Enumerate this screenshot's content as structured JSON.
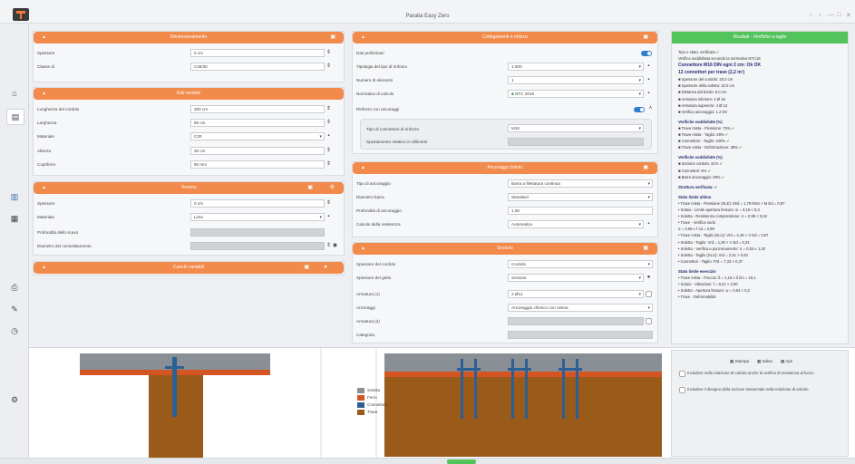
{
  "app": {
    "title": "Paratia Easy Zero"
  },
  "window_controls": [
    "‹",
    "›",
    "—",
    "□",
    "✕"
  ],
  "sidebar": {
    "icons": [
      "home-icon",
      "calendar-icon",
      "layers-icon",
      "book-icon",
      "print-icon",
      "edit-icon",
      "clock-icon",
      "gear-icon"
    ]
  },
  "panels": {
    "dimensions": {
      "title": "Dimensionamento",
      "rows": [
        {
          "label": "Spessore",
          "value": "0 cm"
        },
        {
          "label": "Classe di",
          "value": "C25/30"
        }
      ]
    },
    "geometry": {
      "title": "Dati cordolo",
      "rows": [
        {
          "label": "Lunghezza del cordolo",
          "value": "300 cm"
        },
        {
          "label": "Larghezza",
          "value": "50 cm"
        },
        {
          "label": "Materiale",
          "value": "C20"
        },
        {
          "label": "Altezza",
          "value": "30 cm"
        },
        {
          "label": "Copriferro",
          "value": "60 mm"
        }
      ]
    },
    "soil": {
      "title": "Terreno",
      "rows": [
        {
          "label": "Spessore",
          "value": "0 cm"
        },
        {
          "label": "Materiale",
          "value": "Limo"
        },
        {
          "label": "Profondità dello scavo",
          "value": ""
        },
        {
          "label": "Diametro del consolidamento",
          "value": ""
        }
      ]
    },
    "loads": {
      "title": "Carichi variabili"
    },
    "connection": {
      "title": "Collegamenti e rinforzi",
      "rows": [
        {
          "label": "Dati preliminari",
          "value": ""
        },
        {
          "label": "Tipologia del tipo di rinforzo",
          "value": "1.000"
        },
        {
          "label": "Numero di elementi",
          "value": "1"
        },
        {
          "label": "Normativa di calcolo",
          "value": "NTC 2018"
        },
        {
          "label": "Rinforzo con ancoraggi",
          "value": ""
        }
      ],
      "sub": {
        "label": "Tipo di connettore di rinforzo",
        "value": "M16",
        "label2": "Spostamento relativo in millimetri"
      }
    },
    "anchors": {
      "title": "Ancoraggi chimici",
      "rows": [
        {
          "label": "Tipo di ancoraggio",
          "value": "Barra a filettatura continua"
        },
        {
          "label": "Diametro barra",
          "value": "Standard"
        },
        {
          "label": "Profondità di ancoraggio",
          "value": "1.00"
        },
        {
          "label": "Calcolo della resistenza",
          "value": "Automatica"
        }
      ]
    },
    "section": {
      "title": "Sezione",
      "rows": [
        {
          "label": "Spessore del cordolo",
          "value": "Cordolo"
        },
        {
          "label": "Spessore del getto",
          "value": "Sezione"
        },
        {
          "label": "Armatura (1)",
          "value": "2 Ø12"
        },
        {
          "label": "Ancoraggi",
          "value": "Ancoraggio chimico con resina"
        },
        {
          "label": "Armatura (2)",
          "value": ""
        },
        {
          "label": "Categoria",
          "value": ""
        }
      ]
    }
  },
  "results": {
    "header": "Risultati - Verifiche a taglio",
    "lines": [
      "Tipo e stato: verificata ✔",
      "Verifica soddisfatta secondo la normativa NTC18",
      "Connettore M16 DIN ogni 2 cm: Ok OK",
      "12 connettori per trave (2,2 m²)",
      "■ Spessore del cordolo: 20.0 cm",
      "■ Spessore della soletta: 10.0 cm",
      "■ Distanza dal bordo: 6.0 cm",
      "■ Armatura inferiore: 4 Ø 16",
      "■ Armatura superiore: 4 Ø 12",
      "■ Verifica ancoraggio: 1.2 kN",
      "Verifiche soddisfatte (%)",
      "■ Trave mista - Flessione:  75%  ✔",
      "■ Trave mista - Taglio:  28%  ✔",
      "■ Connettore - Taglio:  100%  ✔",
      "■ Trave mista - Deformazione:  38%  ✔",
      "Verifiche soddisfatte (%)",
      "■ Sezione cordolo:  41%  ✔",
      "■ Connettori:  6%  ✔",
      "■ Barra ancoraggio:  39%  ✔",
      "Struttura verificata: ✔",
      "Stato limite ultimo",
      "• Trave mista - Flessione (SLE): Mrd = 1,79 kNm > M Ed = 0,87",
      "• Solaio - Limite apertura fessure: w = 0,18 < 0,3",
      "• Soletta - Resistenza compressione: σ = 0,99 < 0,62",
      "• Trave - Verifica nodo",
      "    σ = 0,69 ≤ f cd = 0,89",
      "• Trave mista - Taglio (SLU): Vrd = 4,48 > V Ed = 0,57",
      "• Soletta - Taglio: Vrd = 1,00 > V Ed = 0,22",
      "• Soletta - Verifica a punzonamento: σ = 0,53 ≤ 1,20",
      "• Soletta - Taglio (SLU): Vrd = 2,51 > 0,63",
      "• Connettori - Taglio: Prd = 7,33 > 0,37",
      "Stato limite esercizio",
      "• Trave mista - Freccia: δ = 1,19 ≤ δ lim = 15,1",
      "• Solaio - Vibrazioni: f = 8,21 > 3,00",
      "• Soletta - Apertura fessure: w = 0,04 < 0,2",
      "• Trave - Deformabilità"
    ]
  },
  "options": {
    "buttons": [
      "Stampa",
      "Salva",
      "Apri"
    ],
    "items": [
      "Includere nella relazione di calcolo anche la verifica di resistenza al fuoco",
      "Includere il disegno della sezione trasversale nella relazione di calcolo"
    ]
  },
  "legend": [
    {
      "label": "Soletta",
      "color": "#8a8f96"
    },
    {
      "label": "Ferro",
      "color": "#d25522"
    },
    {
      "label": "Connettore",
      "color": "#2c5f94"
    },
    {
      "label": "Trave",
      "color": "#9a5a1a"
    }
  ],
  "colors": {
    "accent": "#f18a4b",
    "success": "#53c35b",
    "toggle": "#2f7fcf"
  }
}
